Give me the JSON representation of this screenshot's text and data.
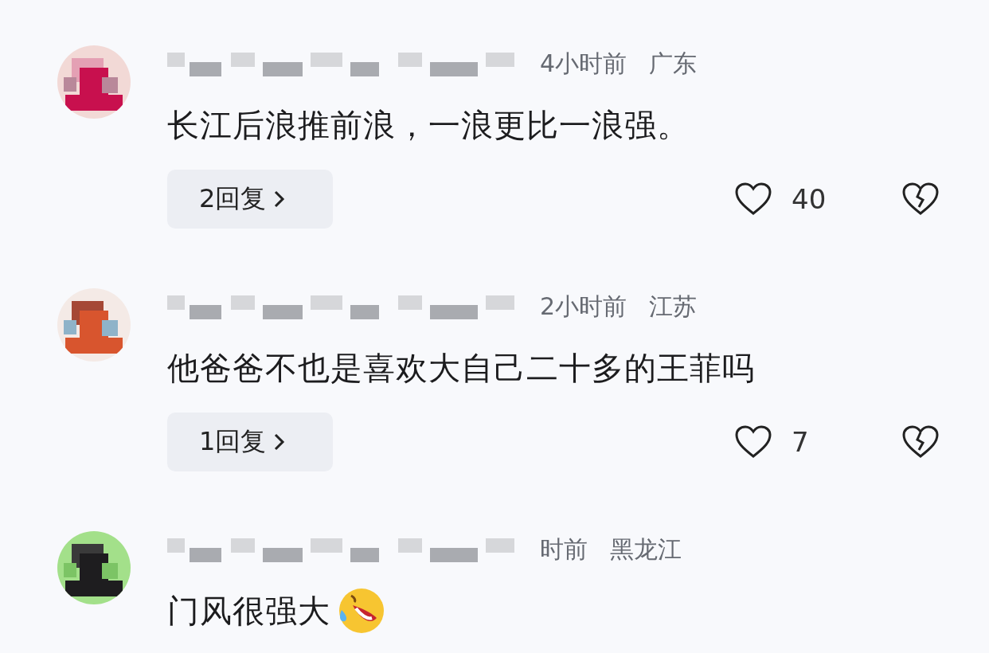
{
  "comments": [
    {
      "time": "4小时前",
      "location": "广东",
      "text": "长江后浪推前浪，一浪更比一浪强。",
      "emoji": false,
      "replies": "2回复",
      "likes": "40"
    },
    {
      "time": "2小时前",
      "location": "江苏",
      "text": "他爸爸不也是喜欢大自己二十多的王菲吗",
      "emoji": false,
      "replies": "1回复",
      "likes": "7"
    },
    {
      "time": "时前",
      "location": "黑龙江",
      "text": "门风很强大",
      "emoji": true
    }
  ]
}
